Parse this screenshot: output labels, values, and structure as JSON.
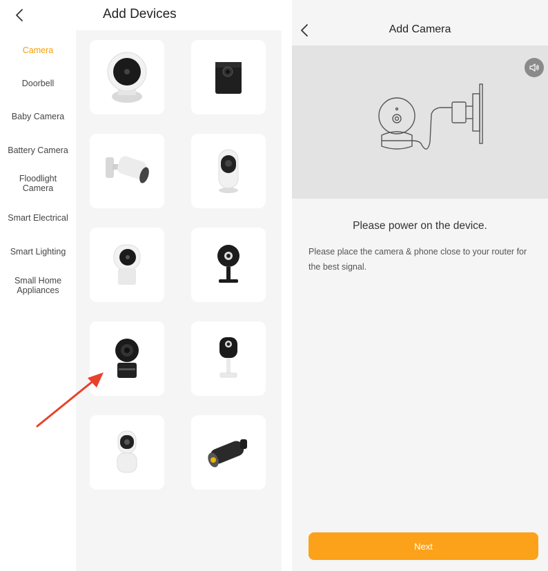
{
  "left": {
    "title": "Add Devices",
    "categories": [
      {
        "label": "Camera",
        "active": true
      },
      {
        "label": "Doorbell",
        "active": false
      },
      {
        "label": "Baby Camera",
        "active": false
      },
      {
        "label": "Battery Camera",
        "active": false
      },
      {
        "label": "Floodlight Camera",
        "active": false
      },
      {
        "label": "Smart Electrical",
        "active": false
      },
      {
        "label": "Smart Lighting",
        "active": false
      },
      {
        "label": "Small Home Appliances",
        "active": false
      }
    ],
    "devices": [
      {
        "icon": "dome-camera-icon"
      },
      {
        "icon": "cube-camera-icon"
      },
      {
        "icon": "bullet-outdoor-camera-icon"
      },
      {
        "icon": "capsule-camera-icon"
      },
      {
        "icon": "desk-camera-icon"
      },
      {
        "icon": "stand-camera-black-icon"
      },
      {
        "icon": "pan-tilt-black-camera-icon"
      },
      {
        "icon": "stand-camera-white-icon"
      },
      {
        "icon": "pan-tilt-white-camera-icon"
      },
      {
        "icon": "bullet-black-camera-icon"
      }
    ],
    "accent_color": "#f59e0b",
    "arrow_color": "#e8412c"
  },
  "right": {
    "title": "Add Camera",
    "step_title": "Please power on the device.",
    "step_desc": "Please place the camera & phone close to your router for the best signal.",
    "next_label": "Next",
    "button_color": "#fba21a"
  }
}
